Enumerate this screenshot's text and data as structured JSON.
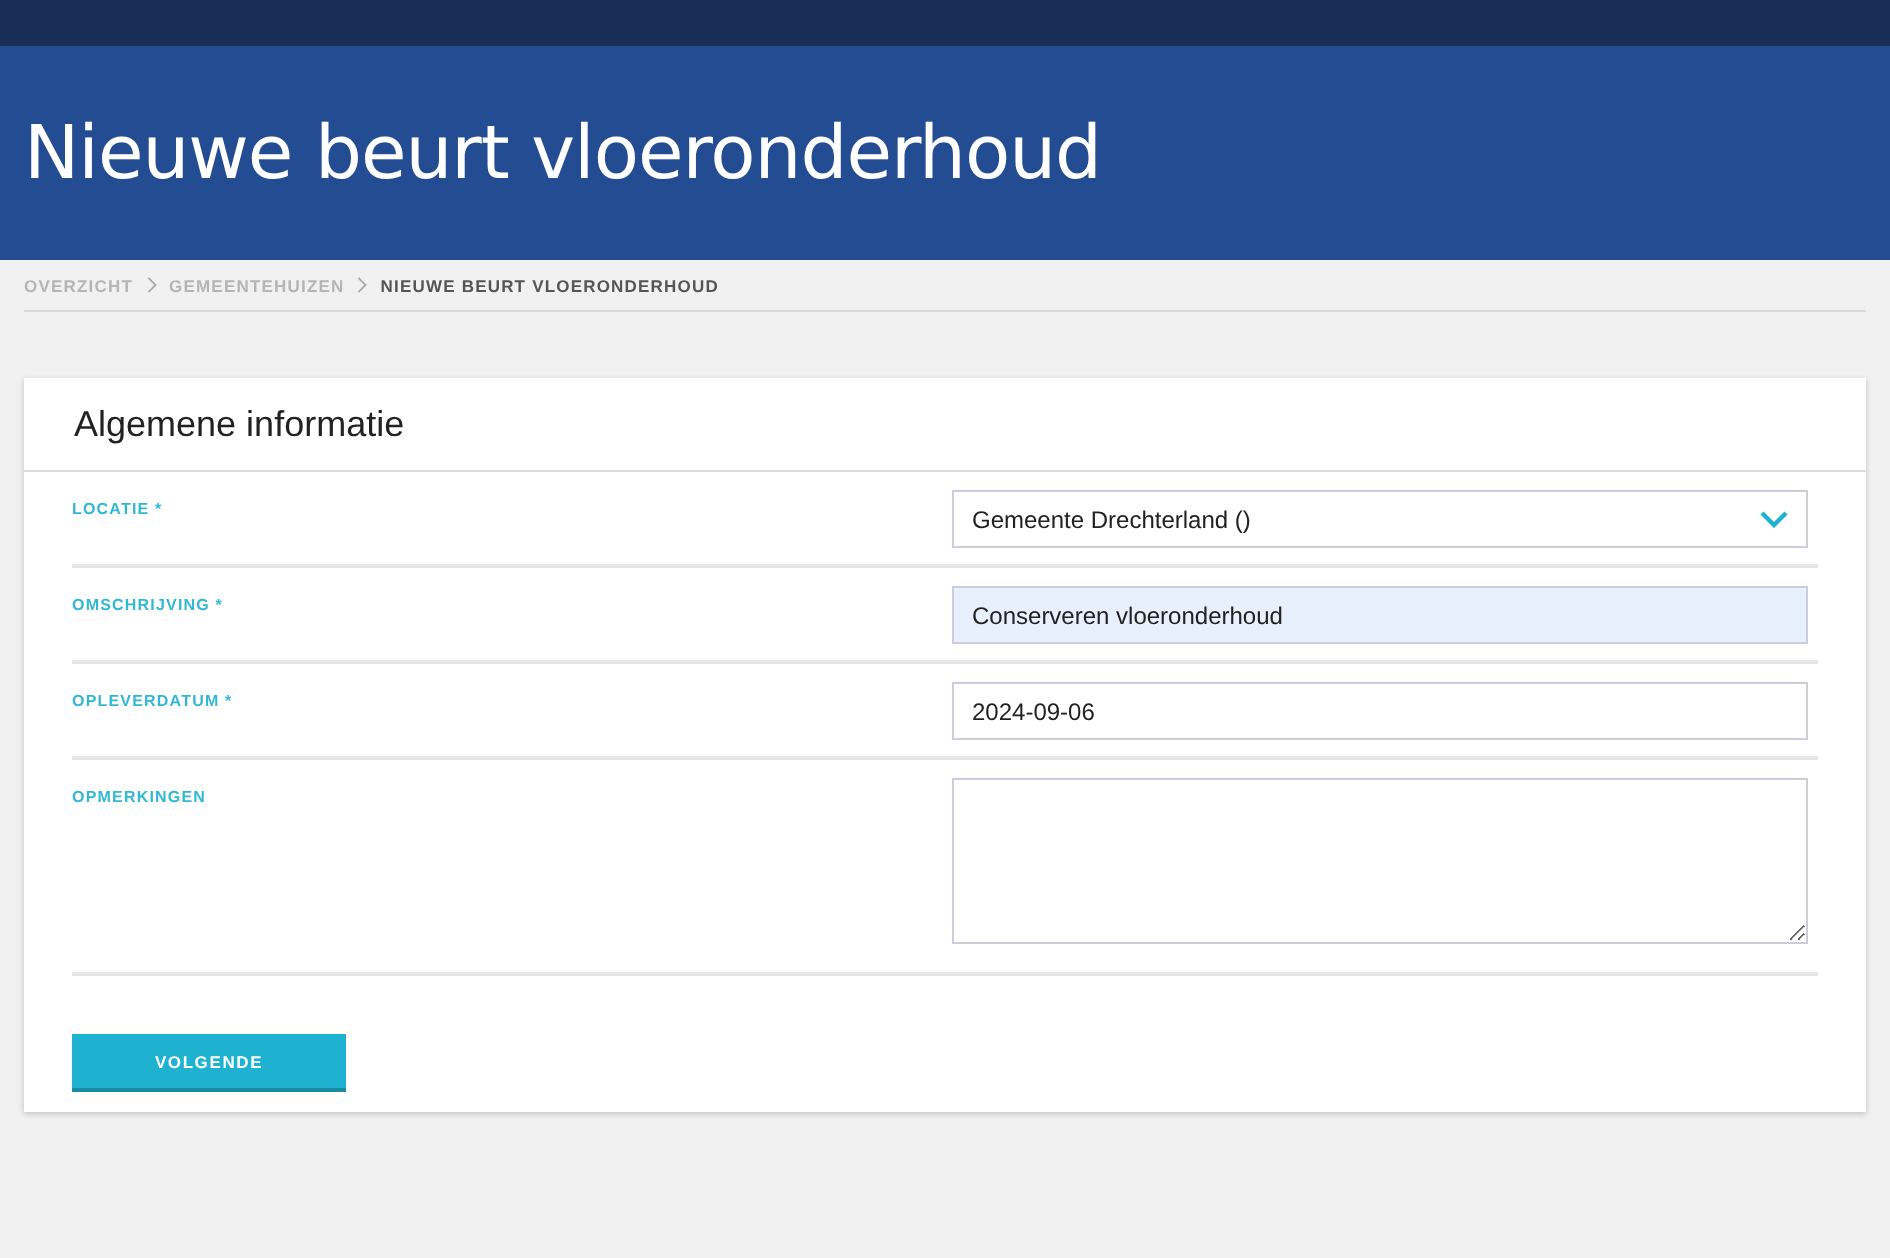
{
  "header": {
    "title": "Nieuwe beurt vloeronderhoud"
  },
  "breadcrumb": [
    {
      "label": "OVERZICHT",
      "current": false
    },
    {
      "label": "GEMEENTEHUIZEN",
      "current": false
    },
    {
      "label": "NIEUWE BEURT VLOERONDERHOUD",
      "current": true
    }
  ],
  "card": {
    "title": "Algemene informatie",
    "fields": [
      {
        "kind": "select",
        "label": "LOCATIE *",
        "value": "Gemeente Drechterland ()",
        "highlighted": false
      },
      {
        "kind": "text",
        "label": "OMSCHRIJVING *",
        "value": "Conserveren vloeronderhoud",
        "highlighted": true
      },
      {
        "kind": "text",
        "label": "OPLEVERDATUM *",
        "value": "2024-09-06",
        "highlighted": false
      },
      {
        "kind": "textarea",
        "label": "OPMERKINGEN",
        "highlighted": false
      }
    ],
    "button": "VOLGENDE"
  }
}
